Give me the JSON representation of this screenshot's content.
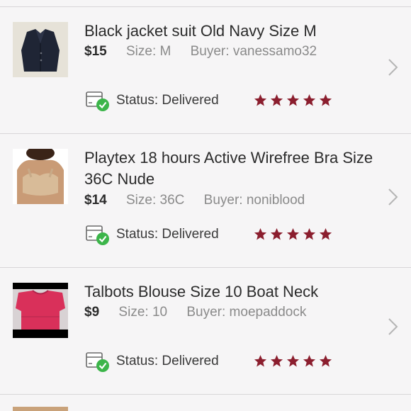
{
  "orders": [
    {
      "title": "Black jacket suit Old Navy Size M",
      "price": "$15",
      "size": "Size: M",
      "buyer": "Buyer: vanessamo32",
      "status": "Status: Delivered",
      "rating": 5,
      "thumb_icon": "black-jacket-photo"
    },
    {
      "title": "Playtex 18 hours Active Wirefree Bra Size 36C Nude",
      "price": "$14",
      "size": "Size: 36C",
      "buyer": "Buyer: noniblood",
      "status": "Status: Delivered",
      "rating": 5,
      "thumb_icon": "nude-bra-photo"
    },
    {
      "title": "Talbots Blouse Size 10 Boat Neck",
      "price": "$9",
      "size": "Size: 10",
      "buyer": "Buyer: moepaddock",
      "status": "Status: Delivered",
      "rating": 5,
      "thumb_icon": "pink-blouse-photo"
    }
  ],
  "colors": {
    "star": "#8b1e2e",
    "check": "#3cb54a",
    "chevron": "#b5b5b5",
    "divider": "#d8d6d8",
    "background": "#f6f5f6"
  }
}
